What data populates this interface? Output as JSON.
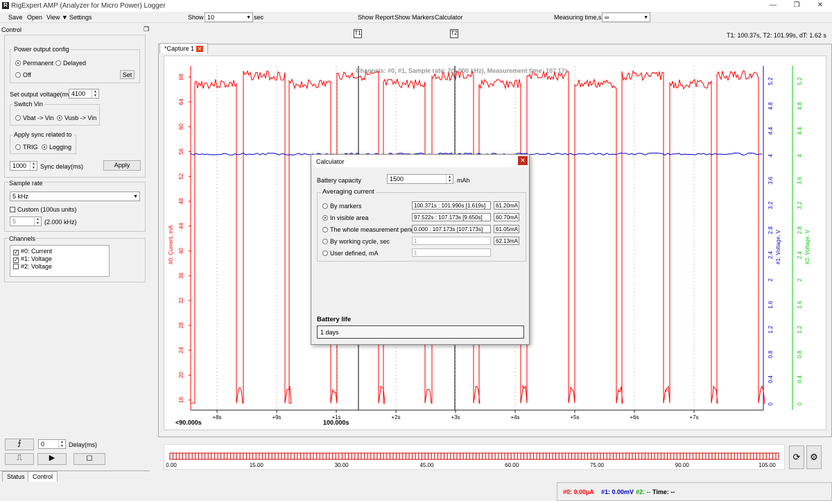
{
  "window": {
    "title": "RigExpert AMP (Analyzer for Micro Power) Logger",
    "icon": "app-icon"
  },
  "menu": {
    "items": [
      "Save",
      "Open",
      "View",
      "Settings"
    ]
  },
  "toolbar": {
    "show_label": "Show",
    "show_value": "10",
    "show_unit": "sec",
    "show_report": "Show Report",
    "show_markers": "Show Markers",
    "calculator": "Calculator",
    "measuring_label": "Measuring time,sec",
    "measuring_value": "∞"
  },
  "control": {
    "title": "Control",
    "power": {
      "title": "Power output config",
      "permanent": "Permanent",
      "delayed": "Delayed",
      "off": "Off",
      "set": "Set"
    },
    "voltage": {
      "label": "Set output voltage(mv)",
      "value": "4100"
    },
    "switch": {
      "title": "Switch Vin",
      "vbat": "Vbat -> Vin",
      "vusb": "Vusb -> Vin"
    },
    "sync": {
      "title": "Apply sync related to",
      "trig": "TRIG",
      "logging": "Logging",
      "delay_value": "1000",
      "delay_label": "Sync delay(ms)",
      "apply": "Apply"
    },
    "sample": {
      "title": "Sample rate",
      "value": "5 kHz",
      "custom": "Custom (100us units)",
      "custom_value": "5",
      "custom_khz": "(2.000 kHz)"
    },
    "channels": {
      "title": "Channels",
      "items": [
        "#0: Current",
        "#1: Voltage",
        "#2: Voltage"
      ],
      "checked": [
        true,
        true,
        false
      ]
    },
    "delay": {
      "value": "0",
      "label": "Delay(ms)"
    },
    "tabs": [
      "Status",
      "Control"
    ]
  },
  "markers": {
    "t1": "T1",
    "t2": "T2",
    "readout": "T1: 100.37s, T2: 101.99s, dT: 1.62 s"
  },
  "capture_tab": "*Capture 1",
  "chart": {
    "info": "Channels: #0, #1,  Sample rate: 2(5.000 kHz), Measurement time: 107.17s",
    "left_axis_label": "#0: Current, mA",
    "right1_label": "#1: Voltage, V",
    "right2_label": "#2: Voltage, V",
    "left_ticks": [
      "68",
      "64",
      "60",
      "56",
      "52",
      "48",
      "44",
      "40",
      "36",
      "32",
      "28",
      "24",
      "20",
      "16"
    ],
    "right1_ticks": [
      "5.2",
      "4.8",
      "4.4",
      "4",
      "3.6",
      "3.2",
      "2.8",
      "2.4",
      "2",
      "1.6",
      "1.2",
      "0.8",
      "0.4",
      "0"
    ],
    "right2_ticks": [
      "5.2",
      "4.8",
      "4.4",
      "4",
      "3.6",
      "3.2",
      "2.8",
      "2.4",
      "2",
      "1.6",
      "1.2",
      "0.8",
      "0.4",
      "0"
    ],
    "x_ticks": [
      "+8s",
      "+9s",
      "+1s",
      "+2s",
      "+3s",
      "+4s",
      "+5s",
      "+6s",
      "+7s"
    ],
    "x_start": "<90.000s",
    "x_mid": "100.000s",
    "colors": {
      "current": "#ff0000",
      "voltage1": "#0000cc",
      "voltage2": "#00cc00"
    }
  },
  "timeline": {
    "ticks": [
      "0.00",
      "15.00",
      "30.00",
      "45.00",
      "60.00",
      "75.00",
      "90.00",
      "105.00"
    ]
  },
  "status": {
    "c0": "#0: 0.00µA",
    "c1": "#1: 0.00mV",
    "c2": "#2: --",
    "time_label": "Time: --"
  },
  "calculator": {
    "title": "Calculator",
    "capacity_label": "Battery capacity",
    "capacity_value": "1500",
    "capacity_unit": "mAh",
    "averaging_title": "Averaging current",
    "rows": [
      {
        "label": "By markers",
        "range": "100.371s : 101.990s [1.619s]",
        "result": "61.20mA",
        "selected": false,
        "disabled": false
      },
      {
        "label": "In visible area",
        "range": "97.522s : 107.173s [9.650s]",
        "result": "60.70mA",
        "selected": true,
        "disabled": false
      },
      {
        "label": "The whole measurement period",
        "range": "0.000 : 107.173s [107.173s]",
        "result": "61.05mA",
        "selected": false,
        "disabled": false
      },
      {
        "label": "By working cycle, sec",
        "range": "1",
        "result": "62.13mA",
        "selected": false,
        "disabled": true
      },
      {
        "label": "User defined, mA",
        "range": "1",
        "result": "",
        "selected": false,
        "disabled": true
      }
    ],
    "battery_life_label": "Battery life",
    "battery_life_value": "1 days"
  }
}
